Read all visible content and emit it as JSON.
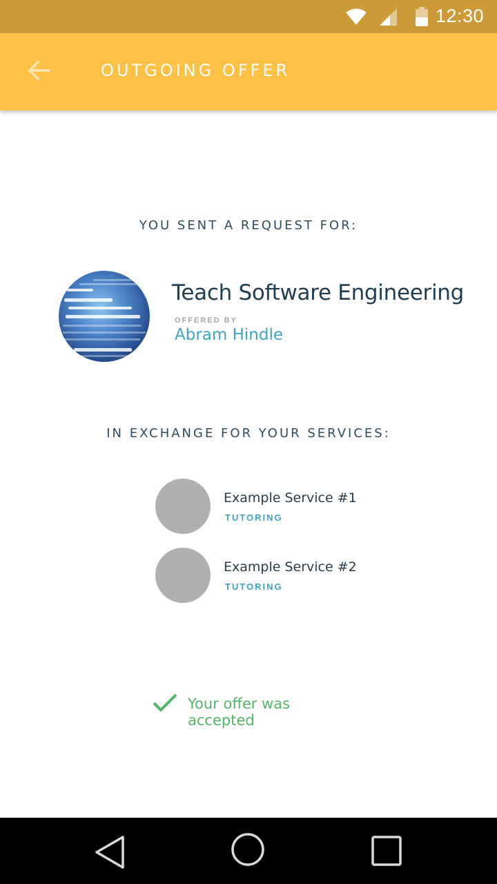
{
  "status_bar": {
    "time": "12:30",
    "icons": [
      "wifi-icon",
      "cell-signal-icon",
      "battery-icon"
    ]
  },
  "app_bar": {
    "back_icon": "arrow-back-icon",
    "title": "OUTGOING OFFER"
  },
  "request": {
    "heading": "YOU SENT A REQUEST FOR:",
    "item_title": "Teach Software Engineering",
    "offered_by_label": "OFFERED BY",
    "offered_by_name": "Abram Hindle"
  },
  "exchange": {
    "heading": "IN EXCHANGE FOR YOUR SERVICES:",
    "services": [
      {
        "name": "Example Service #1",
        "category": "TUTORING"
      },
      {
        "name": "Example Service #2",
        "category": "TUTORING"
      }
    ]
  },
  "offer_status": {
    "icon": "checkmark-icon",
    "text": "Your offer was accepted"
  },
  "nav_bar": {
    "buttons": [
      "back-triangle-icon",
      "home-circle-icon",
      "recents-square-icon"
    ]
  },
  "colors": {
    "status_bar": "#cc9b37",
    "app_bar": "#ffc145",
    "accent_blue": "#3ca4c6",
    "success_green": "#52b469",
    "heading_text": "#2f4b5f"
  }
}
